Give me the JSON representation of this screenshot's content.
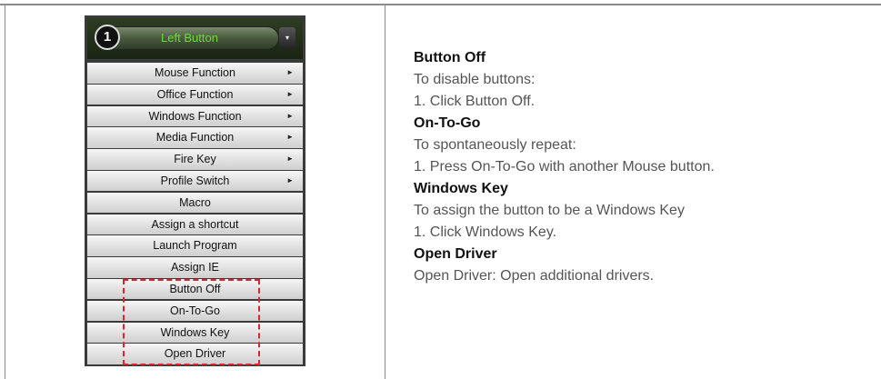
{
  "menu": {
    "badge": "1",
    "header_label": "Left Button",
    "dropdown_glyph": "▾",
    "items": [
      {
        "label": "Mouse Function",
        "submenu": true
      },
      {
        "label": "Office Function",
        "submenu": true
      },
      {
        "label": "Windows Function",
        "submenu": true
      },
      {
        "label": "Media Function",
        "submenu": true
      },
      {
        "label": "Fire Key",
        "submenu": true
      },
      {
        "label": "Profile Switch",
        "submenu": true
      },
      {
        "label": "Macro",
        "submenu": false
      },
      {
        "label": "Assign a shortcut",
        "submenu": false
      },
      {
        "label": "Launch Program",
        "submenu": false
      },
      {
        "label": "Assign IE",
        "submenu": false
      },
      {
        "label": "Button Off",
        "submenu": false
      },
      {
        "label": "On-To-Go",
        "submenu": false
      },
      {
        "label": "Windows Key",
        "submenu": false
      },
      {
        "label": "Open Driver",
        "submenu": false
      }
    ],
    "arrow_glyph": "►",
    "highlight_color": "#e0222a"
  },
  "description": {
    "sections": [
      {
        "heading": "Button Off",
        "lines": [
          "To disable buttons:",
          "1.  Click Button Off."
        ]
      },
      {
        "heading": "On-To-Go",
        "lines": [
          "To spontaneously repeat:",
          "1.  Press On-To-Go with another Mouse button."
        ]
      },
      {
        "heading": "Windows Key",
        "lines": [
          "To assign the button to be a Windows Key",
          "1.  Click Windows Key."
        ]
      },
      {
        "heading": "Open Driver",
        "lines": [
          "Open Driver: Open additional drivers."
        ]
      }
    ]
  }
}
